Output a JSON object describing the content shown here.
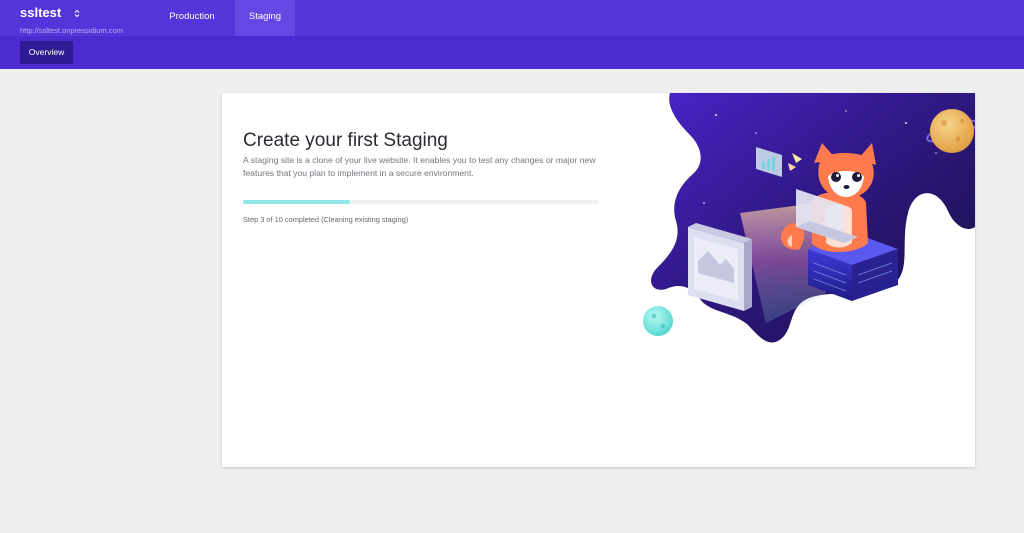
{
  "header": {
    "site_name": "ssltest",
    "site_url": "http://ssltest.onpressidium.com",
    "tabs": [
      {
        "label": "Production",
        "active": false
      },
      {
        "label": "Staging",
        "active": true
      }
    ]
  },
  "subnav": {
    "overview_label": "Overview"
  },
  "main": {
    "title": "Create your first Staging",
    "description": "A staging site is a clone of your live website. It enables you to test any changes or major new features that you plan to implement in a secure environment.",
    "progress": {
      "current_step": 3,
      "total_steps": 10,
      "fraction": 0.3,
      "status_text": "Step 3 of 10 completed (Cleaning existing staging)"
    }
  },
  "colors": {
    "header_bg": "#5535d9",
    "subnav_bg": "#4b2bcf",
    "active_tab_bg": "#6547e4",
    "overview_btn_bg": "#2f1a95",
    "progress_fill": "#8ee8e8",
    "page_bg": "#efeff1"
  },
  "illustration": {
    "icon": "fox-at-computer-illustration"
  }
}
